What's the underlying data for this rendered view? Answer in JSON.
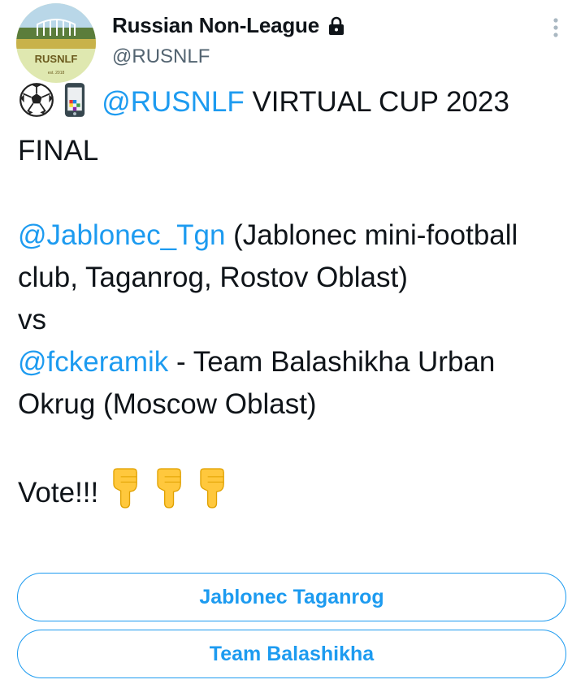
{
  "author": {
    "display_name": "Russian Non-League",
    "handle": "@RUSNLF",
    "avatar_text": "RUSNLF",
    "avatar_subtext": "est. 2018"
  },
  "tweet": {
    "mention_1": "@RUSNLF",
    "title_rest": " VIRTUAL CUP 2023 FINAL",
    "mention_2": "@Jablonec_Tgn",
    "team_1_desc": " (Jablonec mini-football club, Taganrog, Rostov Oblast)",
    "vs": "vs",
    "mention_3": "@fckeramik",
    "team_2_desc": " - Team Balashikha Urban Okrug (Moscow Oblast)",
    "vote": "Vote!!! "
  },
  "poll": {
    "options": [
      "Jablonec Taganrog",
      "Team Balashikha"
    ]
  },
  "icons": {
    "lock": "lock-icon",
    "more": "more-options-icon",
    "emojis": [
      "soccer-ball-icon",
      "mobile-phone-icon",
      "pointing-down-icon"
    ]
  },
  "colors": {
    "accent": "#1d9bf0",
    "text": "#0f1419",
    "secondary": "#536471"
  }
}
